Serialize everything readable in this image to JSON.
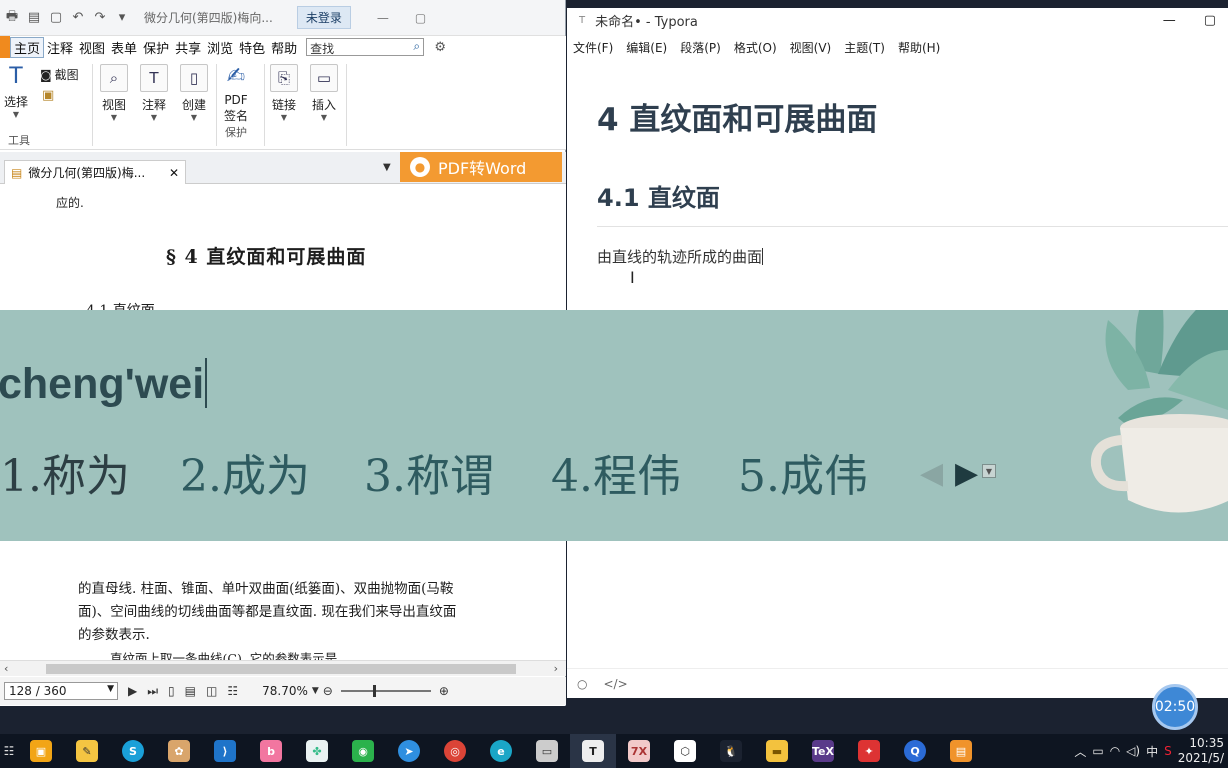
{
  "pdf": {
    "doc_title": "微分几何(第四版)梅向...",
    "login_button": "未登录",
    "menu": [
      "主页",
      "注释",
      "视图",
      "表单",
      "保护",
      "共享",
      "浏览",
      "特色",
      "帮助"
    ],
    "search_placeholder": "查找",
    "ribbon": {
      "select": "选择",
      "screenshot": "截图",
      "tools_group": "工具",
      "view": "视图",
      "annotate": "注释",
      "create": "创建",
      "pdf_sign_1": "PDF",
      "pdf_sign_2": "签名",
      "protect_group": "保护",
      "link": "链接",
      "insert": "插入"
    },
    "tab_label": "微分几何(第四版)梅...",
    "pdf_to_word": "PDF转Word",
    "page": {
      "line_top": "应的.",
      "section_heading": "§ 4    直纹面和可展曲面",
      "subsection": "4.1   直纹面",
      "para_line_1": "的直母线. 柱面、锥面、单叶双曲面(纸篓面)、双曲抛物面(马鞍",
      "para_line_2": "面)、空间曲线的切线曲面等都是直纹面. 现在我们来导出直纹面",
      "para_line_3": "的参数表示.",
      "tail_line": "直纹面上取一条曲线(C), 它的参数表示是"
    },
    "page_indicator": "128 / 360",
    "zoom": "78.70%"
  },
  "typora": {
    "title": "未命名• - Typora",
    "menu": [
      "文件(F)",
      "编辑(E)",
      "段落(P)",
      "格式(O)",
      "视图(V)",
      "主题(T)",
      "帮助(H)"
    ],
    "h1": "4  直纹面和可展曲面",
    "h2": "4.1 直纹面",
    "paragraph": "由直线的轨迹所成的曲面"
  },
  "ime": {
    "pinyin": "cheng'wei",
    "candidates": [
      "1.称为",
      "2.成为",
      "3.称谓",
      "4.程伟",
      "5.成伟"
    ]
  },
  "timer": "02:50",
  "taskbar": {
    "ime_lang": "中",
    "time": "10:35",
    "date": "2021/5/"
  }
}
